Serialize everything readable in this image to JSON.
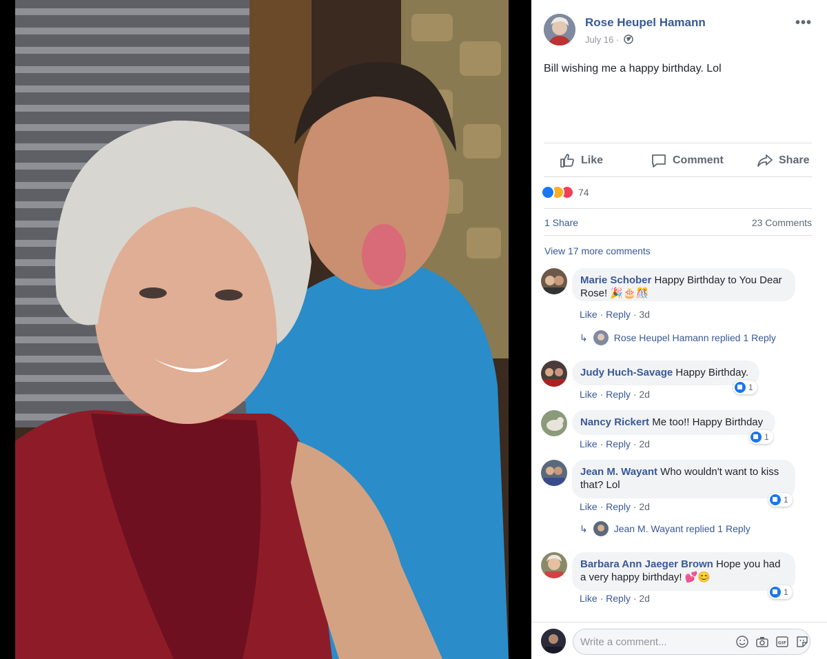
{
  "post": {
    "author": "Rose Heupel Hamann",
    "date": "July 16 ·",
    "text": "Bill wishing me a happy birthday. Lol"
  },
  "actions": {
    "like": "Like",
    "comment": "Comment",
    "share": "Share"
  },
  "reactions": {
    "count": "74",
    "icons": [
      "like-reaction",
      "haha-reaction",
      "love-reaction"
    ]
  },
  "stats": {
    "shares": "1 Share",
    "comments": "23 Comments"
  },
  "view_more": "View 17 more comments",
  "comments": [
    {
      "name": "Marie Schober",
      "text": "Happy Birthday to You Dear",
      "text2": "Rose! 🎉🎂🎊",
      "like": "Like",
      "reply": "Reply",
      "time": "3d",
      "replied": {
        "who": "Rose Heupel Hamann replied",
        "count": "1 Reply"
      }
    },
    {
      "name": "Judy Huch-Savage",
      "text": "Happy Birthday.",
      "like": "Like",
      "reply": "Reply",
      "time": "2d",
      "likes": "1"
    },
    {
      "name": "Nancy Rickert",
      "text": "Me too!! Happy Birthday",
      "like": "Like",
      "reply": "Reply",
      "time": "2d",
      "likes": "1"
    },
    {
      "name": "Jean M. Wayant",
      "text": "Who wouldn't want to kiss",
      "text2": "that? Lol",
      "like": "Like",
      "reply": "Reply",
      "time": "2d",
      "likes": "1",
      "replied": {
        "who": "Jean M. Wayant replied",
        "count": "1 Reply"
      }
    },
    {
      "name": "Barbara Ann Jaeger Brown",
      "text": "Hope you had",
      "text2": "a very happy birthday! 💕😊",
      "like": "Like",
      "reply": "Reply",
      "time": "2d",
      "likes": "1"
    }
  ],
  "separator": " · ",
  "composer": {
    "placeholder": "Write a comment...",
    "icons": [
      "emoji-icon",
      "camera-icon",
      "gif-icon",
      "sticker-icon"
    ],
    "gif_label": "GIF"
  },
  "colors": {
    "link": "#385898",
    "muted": "#606770",
    "bubble": "#f2f3f5",
    "like_blue": "#1877f2"
  }
}
